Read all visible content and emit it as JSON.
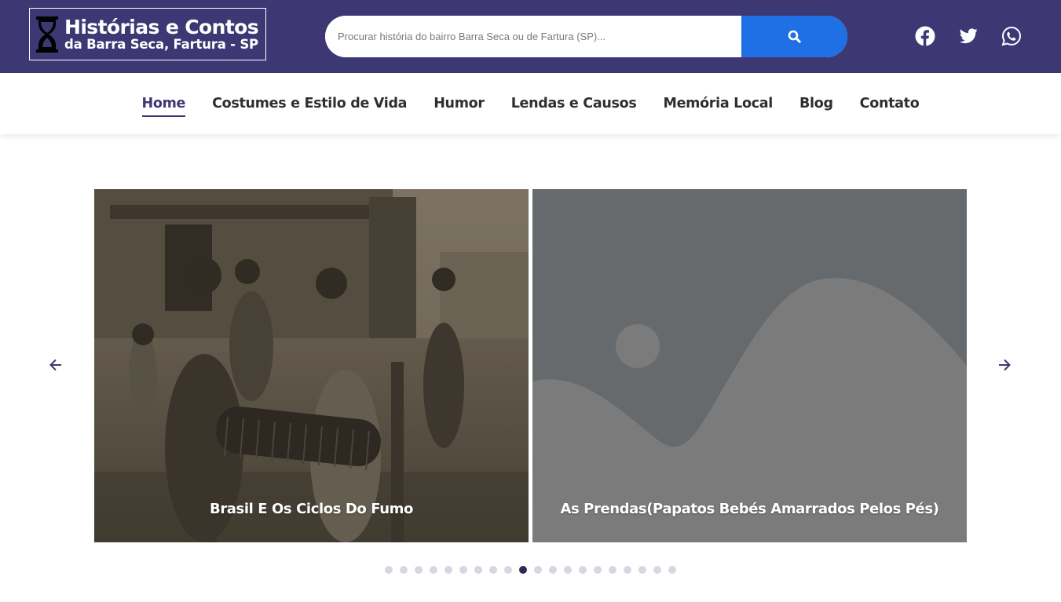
{
  "brand": {
    "title_line1": "Histórias e Contos",
    "title_line2": "da Barra Seca, Fartura - SP",
    "icon": "hourglass-icon"
  },
  "search": {
    "placeholder": "Procurar história do bairro Barra Seca ou de Fartura (SP)...",
    "value": "",
    "button_icon": "search-icon"
  },
  "social": [
    {
      "name": "facebook",
      "icon": "facebook-icon"
    },
    {
      "name": "twitter",
      "icon": "twitter-icon"
    },
    {
      "name": "whatsapp",
      "icon": "whatsapp-icon"
    }
  ],
  "nav": {
    "items": [
      {
        "label": "Home",
        "active": true
      },
      {
        "label": "Costumes e Estilo de Vida",
        "active": false
      },
      {
        "label": "Humor",
        "active": false
      },
      {
        "label": "Lendas e Causos",
        "active": false
      },
      {
        "label": "Memória Local",
        "active": false
      },
      {
        "label": "Blog",
        "active": false
      },
      {
        "label": "Contato",
        "active": false
      }
    ]
  },
  "carousel": {
    "slides": [
      {
        "title": "Brasil E Os Ciclos Do Fumo",
        "image": "sepia-photo"
      },
      {
        "title": "As Prendas(Papatos Bebés Amarrados Pelos Pés)",
        "image": "placeholder-image"
      }
    ],
    "prev_icon": "arrow-left-icon",
    "next_icon": "arrow-right-icon",
    "dot_count": 20,
    "active_dot_index": 9
  },
  "colors": {
    "header_bg": "#3d3773",
    "search_button": "#1f6fe5",
    "nav_text": "#2f2f2f",
    "nav_active": "#3d3773",
    "dot_inactive": "#d8d6e3",
    "dot_active": "#2d2a55"
  }
}
